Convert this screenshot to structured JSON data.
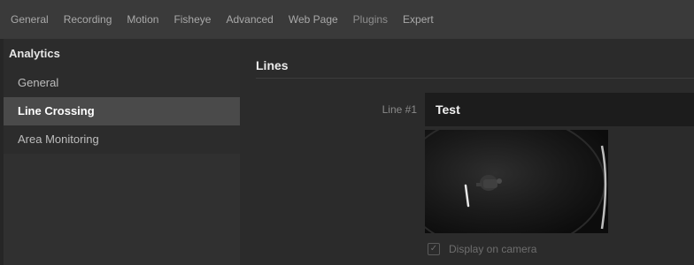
{
  "tabs": [
    {
      "label": "General"
    },
    {
      "label": "Recording"
    },
    {
      "label": "Motion"
    },
    {
      "label": "Fisheye"
    },
    {
      "label": "Advanced"
    },
    {
      "label": "Web Page"
    },
    {
      "label": "Plugins"
    },
    {
      "label": "Expert"
    }
  ],
  "active_tab": "Plugins",
  "sidebar": {
    "title": "Analytics",
    "items": [
      {
        "label": "General"
      },
      {
        "label": "Line Crossing"
      },
      {
        "label": "Area Monitoring"
      }
    ],
    "active_item": "Line Crossing"
  },
  "main": {
    "section_title": "Lines",
    "line_label": "Line #1",
    "line_value": "Test",
    "display_on_camera_label": "Display on camera",
    "display_on_camera_checked": true
  },
  "icons": {
    "checkbox_check": "check-icon"
  }
}
